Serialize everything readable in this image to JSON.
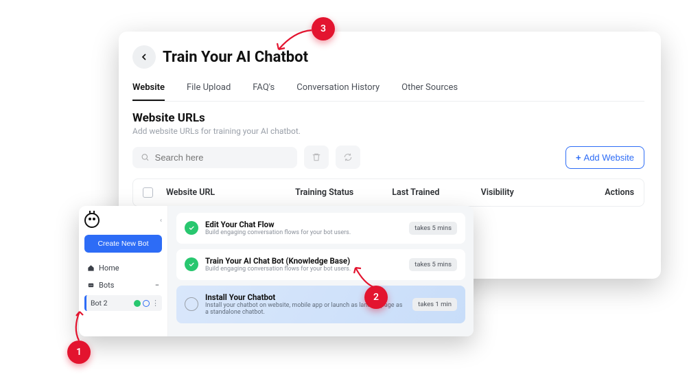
{
  "page": {
    "title": "Train Your AI Chatbot",
    "tabs": [
      "Website",
      "File Upload",
      "FAQ's",
      "Conversation History",
      "Other Sources"
    ],
    "active_tab": 0,
    "section_title": "Website URLs",
    "section_sub": "Add website URLs for training your AI chatbot.",
    "search_placeholder": "Search here",
    "add_btn": "Add Website",
    "columns": [
      "Website URL",
      "Training Status",
      "Last Trained",
      "Visibility",
      "Actions"
    ]
  },
  "sidebar": {
    "create_btn": "Create New Bot",
    "nav_home": "Home",
    "nav_bots": "Bots",
    "bot_name": "Bot 2"
  },
  "cards": [
    {
      "title": "Edit Your Chat Flow",
      "sub": "Build engaging conversation flows for your bot users.",
      "time": "takes 5 mins",
      "state": "done"
    },
    {
      "title": "Train Your AI Chat Bot (Knowledge Base)",
      "sub": "Build engaging conversation flows for your bot users.",
      "time": "takes 5 mins",
      "state": "done"
    },
    {
      "title": "Install Your Chatbot",
      "sub": "Install your chatbot on website, mobile app or launch as landing page as a standalone chatbot.",
      "time": "takes 1 min",
      "state": "pending"
    }
  ],
  "annotations": {
    "b1": "1",
    "b2": "2",
    "b3": "3"
  }
}
